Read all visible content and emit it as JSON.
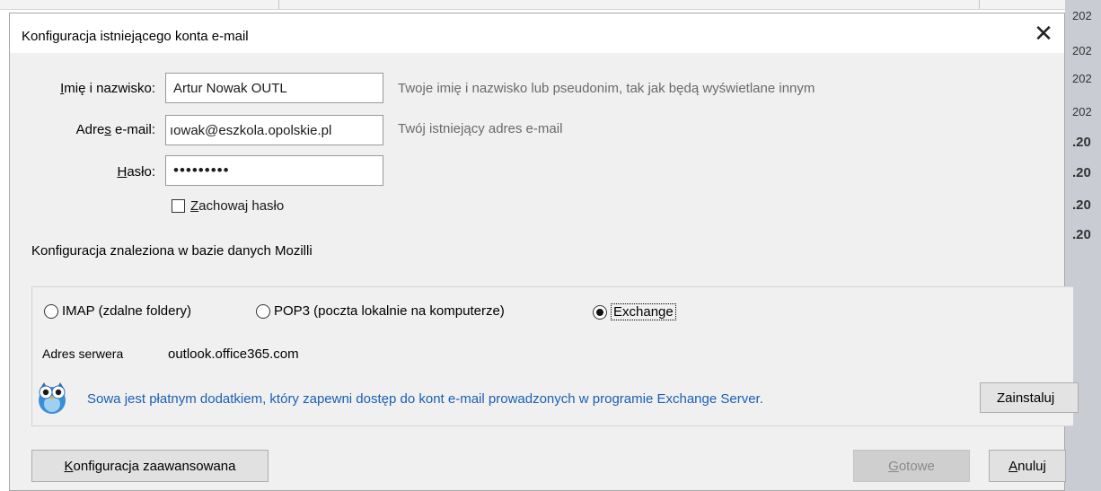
{
  "background": {
    "dates": [
      "202",
      "202",
      "202",
      "202",
      ".20",
      ".20",
      ".20",
      ".20"
    ]
  },
  "dialog": {
    "title": "Konfiguracja istniejącego konta e-mail",
    "close_glyph": "✕"
  },
  "form": {
    "name": {
      "label_prefix": "I",
      "label_rest": "mię i nazwisko:",
      "value": "Artur Nowak OUTL",
      "hint": "Twoje imię i nazwisko lub pseudonim, tak jak będą wyświetlane innym"
    },
    "email": {
      "label_prefix": "Adre",
      "label_key": "s",
      "label_rest": " e-mail:",
      "value": "ıowak@eszkola.opolskie.pl",
      "hint": "Twój istniejący adres e-mail"
    },
    "password": {
      "label_prefix": "H",
      "label_rest": "asło:",
      "value": "•••••••••"
    },
    "remember": {
      "label_key": "Z",
      "label_rest": "achowaj hasło",
      "checked": false
    }
  },
  "found_text": "Konfiguracja znaleziona w bazie danych Mozilli",
  "protocols": [
    {
      "label": "IMAP (zdalne foldery)",
      "checked": false
    },
    {
      "label": "POP3 (poczta lokalnie na komputerze)",
      "checked": false
    },
    {
      "label": "Exchange",
      "checked": true
    }
  ],
  "server": {
    "label": "Adres serwera",
    "value": "outlook.office365.com"
  },
  "owl_notice": {
    "text": "Sowa jest płatnym dodatkiem, który zapewni dostęp do kont e-mail prowadzonych w programie Exchange Server.",
    "install_label": "Zainstaluj",
    "icon": "owl-icon"
  },
  "buttons": {
    "advanced_key": "K",
    "advanced_rest": "onfiguracja zaawansowana",
    "done_key": "G",
    "done_rest": "otowe",
    "cancel_key": "A",
    "cancel_rest": "nuluj"
  },
  "colors": {
    "link": "#1a5fb4",
    "dialog_bg": "#f0f0f0",
    "hint": "#6a6a6a"
  }
}
